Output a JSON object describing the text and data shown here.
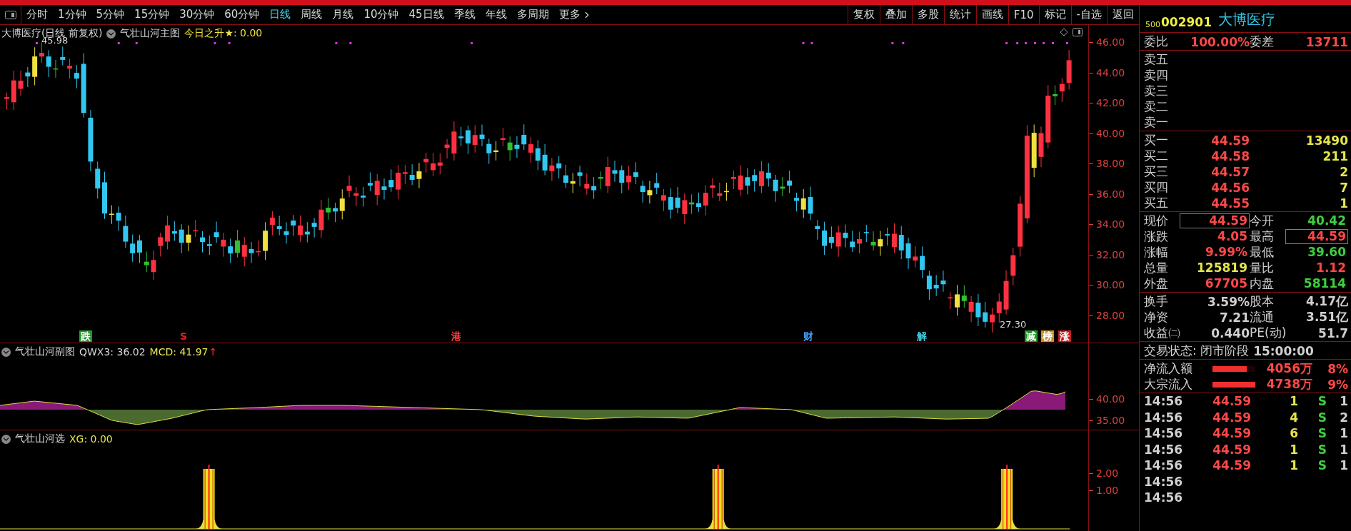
{
  "toolbar": {
    "periods": [
      {
        "label": "分时",
        "selected": false
      },
      {
        "label": "1分钟",
        "selected": false
      },
      {
        "label": "5分钟",
        "selected": false
      },
      {
        "label": "15分钟",
        "selected": false
      },
      {
        "label": "30分钟",
        "selected": false
      },
      {
        "label": "60分钟",
        "selected": false
      },
      {
        "label": "日线",
        "selected": true
      },
      {
        "label": "周线",
        "selected": false
      },
      {
        "label": "月线",
        "selected": false
      },
      {
        "label": "10分钟",
        "selected": false
      },
      {
        "label": "45日线",
        "selected": false
      },
      {
        "label": "季线",
        "selected": false
      },
      {
        "label": "年线",
        "selected": false
      },
      {
        "label": "多周期",
        "selected": false
      },
      {
        "label": "更多",
        "selected": false
      }
    ],
    "actions": [
      "复权",
      "叠加",
      "多股",
      "统计",
      "画线",
      "F10",
      "标记",
      "-自选",
      "返回"
    ]
  },
  "main_chart": {
    "title": "大博医疗(日线 前复权)",
    "indicator": "气壮山河主图",
    "readout": "今日之升★: 0.00",
    "high_label": "45.98",
    "low_label": "27.30",
    "markers": [
      {
        "text": "跌",
        "color": "#1f9a2a",
        "filled": true
      },
      {
        "text": "S",
        "color": "#e02020",
        "filled": false
      },
      {
        "text": "港",
        "color": "#ff4040",
        "filled": false
      },
      {
        "text": "财",
        "color": "#40a0ff",
        "filled": false
      },
      {
        "text": "解",
        "color": "#40d0e0",
        "filled": false
      },
      {
        "text": "减",
        "color": "#1f9a2a",
        "filled": true
      },
      {
        "text": "榜",
        "color": "#c89020",
        "filled": true
      },
      {
        "text": "涨",
        "color": "#c02020",
        "filled": true
      }
    ],
    "axis": [
      "46.00",
      "44.00",
      "42.00",
      "40.00",
      "38.00",
      "36.00",
      "34.00",
      "32.00",
      "30.00",
      "28.00"
    ]
  },
  "sub_chart": {
    "name": "气壮山河副图",
    "readouts": [
      {
        "text": "QWX3: 36.02",
        "color": "#d8d8d8"
      },
      {
        "text": "MCD: 41.97",
        "color": "#e6e64c"
      }
    ],
    "trend": "↑",
    "axis": [
      "40.00",
      "35.00"
    ]
  },
  "signal_chart": {
    "name": "气壮山河选",
    "readout": "XG: 0.00",
    "axis": [
      "2.00",
      "1.00"
    ]
  },
  "quote": {
    "badge": "500",
    "code": "002901",
    "name": "大博医疗",
    "ratio": {
      "label": "委比",
      "value": "100.00%",
      "diff_label": "委差",
      "diff": "13711"
    },
    "sells": [
      "卖五",
      "卖四",
      "卖三",
      "卖二",
      "卖一"
    ],
    "buys": [
      {
        "label": "买一",
        "price": "44.59",
        "volume": "13490"
      },
      {
        "label": "买二",
        "price": "44.58",
        "volume": "211"
      },
      {
        "label": "买三",
        "price": "44.57",
        "volume": "2"
      },
      {
        "label": "买四",
        "price": "44.56",
        "volume": "7"
      },
      {
        "label": "买五",
        "price": "44.55",
        "volume": "1"
      }
    ],
    "stats": [
      {
        "label": "现价",
        "value": "44.59",
        "color": "#ff4848",
        "boxed": true
      },
      {
        "label": "今开",
        "value": "40.42",
        "color": "#3ecf3e",
        "boxed": false
      },
      {
        "label": "涨跌",
        "value": "4.05",
        "color": "#ff4848",
        "boxed": false
      },
      {
        "label": "最高",
        "value": "44.59",
        "color": "#ff4848",
        "boxed": true
      },
      {
        "label": "涨幅",
        "value": "9.99%",
        "color": "#ff4848",
        "boxed": false
      },
      {
        "label": "最低",
        "value": "39.60",
        "color": "#3ecf3e",
        "boxed": false
      },
      {
        "label": "总量",
        "value": "125819",
        "color": "#e6e64c",
        "boxed": false
      },
      {
        "label": "量比",
        "value": "1.12",
        "color": "#ff4848",
        "boxed": false
      },
      {
        "label": "外盘",
        "value": "67705",
        "color": "#ff4848",
        "boxed": false
      },
      {
        "label": "内盘",
        "value": "58114",
        "color": "#3ecf3e",
        "boxed": false
      }
    ],
    "fundamentals": [
      {
        "label": "换手",
        "value": "3.59%"
      },
      {
        "label": "股本",
        "value": "4.17亿"
      },
      {
        "label": "净资",
        "value": "7.21"
      },
      {
        "label": "流通",
        "value": "3.51亿"
      },
      {
        "label": "收益㈡",
        "value": "0.440"
      },
      {
        "label": "PE(动)",
        "value": "51.7"
      }
    ],
    "status": {
      "label": "交易状态: 闭市阶段",
      "time": "15:00:00"
    },
    "flows": [
      {
        "label": "净流入额",
        "level": 0.8,
        "amount": "4056万",
        "percent": "8%"
      },
      {
        "label": "大宗流入",
        "level": 1,
        "amount": "4738万",
        "percent": "9%"
      }
    ],
    "trades": [
      {
        "time": "14:56",
        "price": "44.59",
        "volume": "1",
        "side": "S",
        "count": "1"
      },
      {
        "time": "14:56",
        "price": "44.59",
        "volume": "4",
        "side": "S",
        "count": "2"
      },
      {
        "time": "14:56",
        "price": "44.59",
        "volume": "6",
        "side": "S",
        "count": "1"
      },
      {
        "time": "14:56",
        "price": "44.59",
        "volume": "1",
        "side": "S",
        "count": "1"
      },
      {
        "time": "14:56",
        "price": "44.59",
        "volume": "1",
        "side": "S",
        "count": "1"
      },
      {
        "time": "14:56"
      },
      {
        "time": "14:56"
      }
    ]
  }
}
